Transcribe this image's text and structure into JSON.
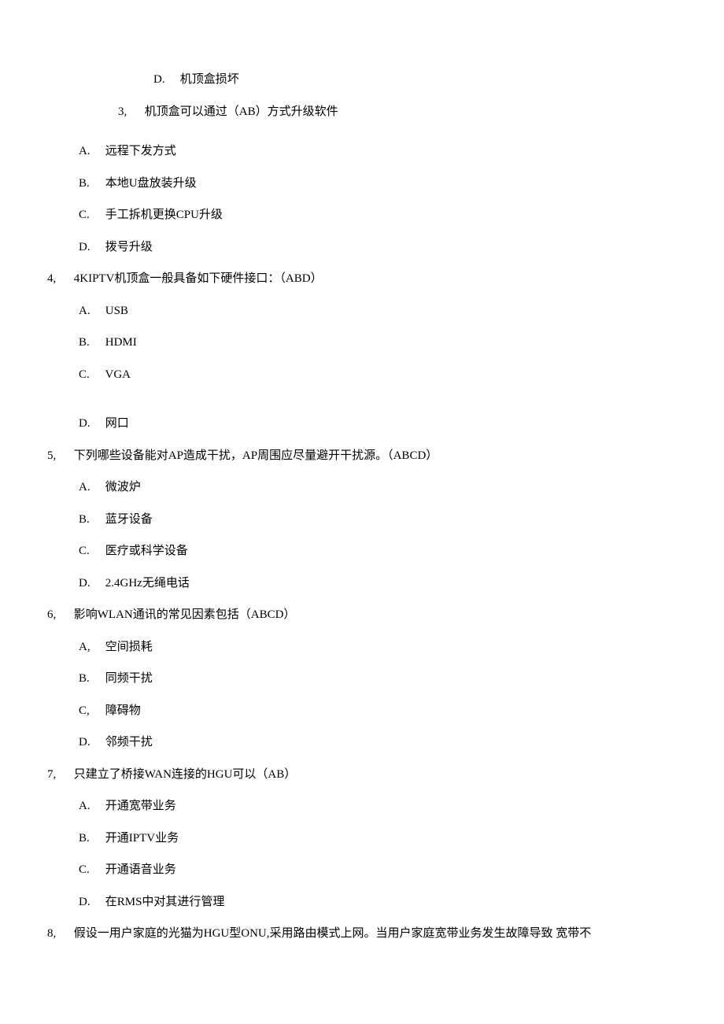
{
  "topOption": {
    "label": "D.",
    "text": "机顶盒损坏"
  },
  "innerQuestion": {
    "label": "3,",
    "text": "机顶盒可以通过（AB）方式升级软件"
  },
  "q3options": [
    {
      "label": "A.",
      "text": "远程下发方式"
    },
    {
      "label": "B.",
      "text": "本地U盘放装升级"
    },
    {
      "label": "C.",
      "text": "手工拆机更换CPU升级"
    },
    {
      "label": "D.",
      "text": "拨号升级"
    }
  ],
  "q4": {
    "label": "4,",
    "text": "4KIPTV机顶盒一般具备如下硬件接口：（ABD）",
    "options": [
      {
        "label": "A.",
        "text": "USB"
      },
      {
        "label": "B.",
        "text": "HDMI"
      },
      {
        "label": "C.",
        "text": "VGA"
      },
      {
        "label": "D.",
        "text": "网口"
      }
    ]
  },
  "q5": {
    "label": "5,",
    "text": "下列哪些设备能对AP造成干扰，AP周围应尽量避开干扰源。（ABCD）",
    "options": [
      {
        "label": "A.",
        "text": "微波炉"
      },
      {
        "label": "B.",
        "text": "蓝牙设备"
      },
      {
        "label": "C.",
        "text": "医疗或科学设备"
      },
      {
        "label": "D.",
        "text": "2.4GHz无绳电话"
      }
    ]
  },
  "q6": {
    "label": "6,",
    "text": "影响WLAN通讯的常见因素包括（ABCD）",
    "options": [
      {
        "label": "A,",
        "text": "空间损耗"
      },
      {
        "label": "B.",
        "text": "同频干扰"
      },
      {
        "label": "C,",
        "text": "障碍物"
      },
      {
        "label": "D.",
        "text": "邻频干扰"
      }
    ]
  },
  "q7": {
    "label": "7,",
    "text": "只建立了桥接WAN连接的HGU可以（AB）",
    "options": [
      {
        "label": "A.",
        "text": "开通宽带业务"
      },
      {
        "label": "B.",
        "text": "开通IPTV业务"
      },
      {
        "label": "C.",
        "text": "开通语音业务"
      },
      {
        "label": "D.",
        "text": "在RMS中对其进行管理"
      }
    ]
  },
  "q8": {
    "label": "8,",
    "text": "假设一用户家庭的光猫为HGU型ONU,采用路由模式上网。当用户家庭宽带业务发生故障导致 宽带不"
  }
}
